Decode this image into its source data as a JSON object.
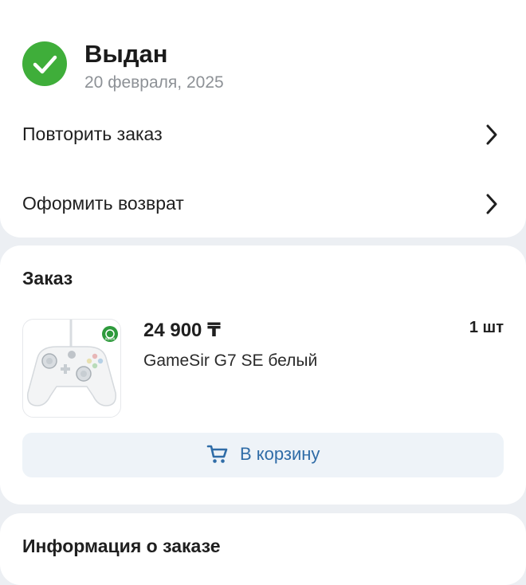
{
  "status": {
    "title": "Выдан",
    "date": "20 февраля, 2025"
  },
  "actions": {
    "repeat_label": "Повторить заказ",
    "return_label": "Оформить возврат"
  },
  "order": {
    "section_title": "Заказ",
    "item": {
      "price": "24 900 ₸",
      "quantity": "1 шт",
      "name": "GameSir G7 SE белый",
      "image_badge": "XBOX"
    },
    "cart_button_label": "В корзину"
  },
  "info": {
    "section_title": "Информация о заказе"
  },
  "colors": {
    "status_green": "#3fae3a",
    "accent_blue": "#2f6ca7",
    "background": "#eceff3"
  },
  "icons": {
    "status": "check-circle-icon",
    "row_action": "chevron-right-icon",
    "cart": "cart-icon"
  }
}
